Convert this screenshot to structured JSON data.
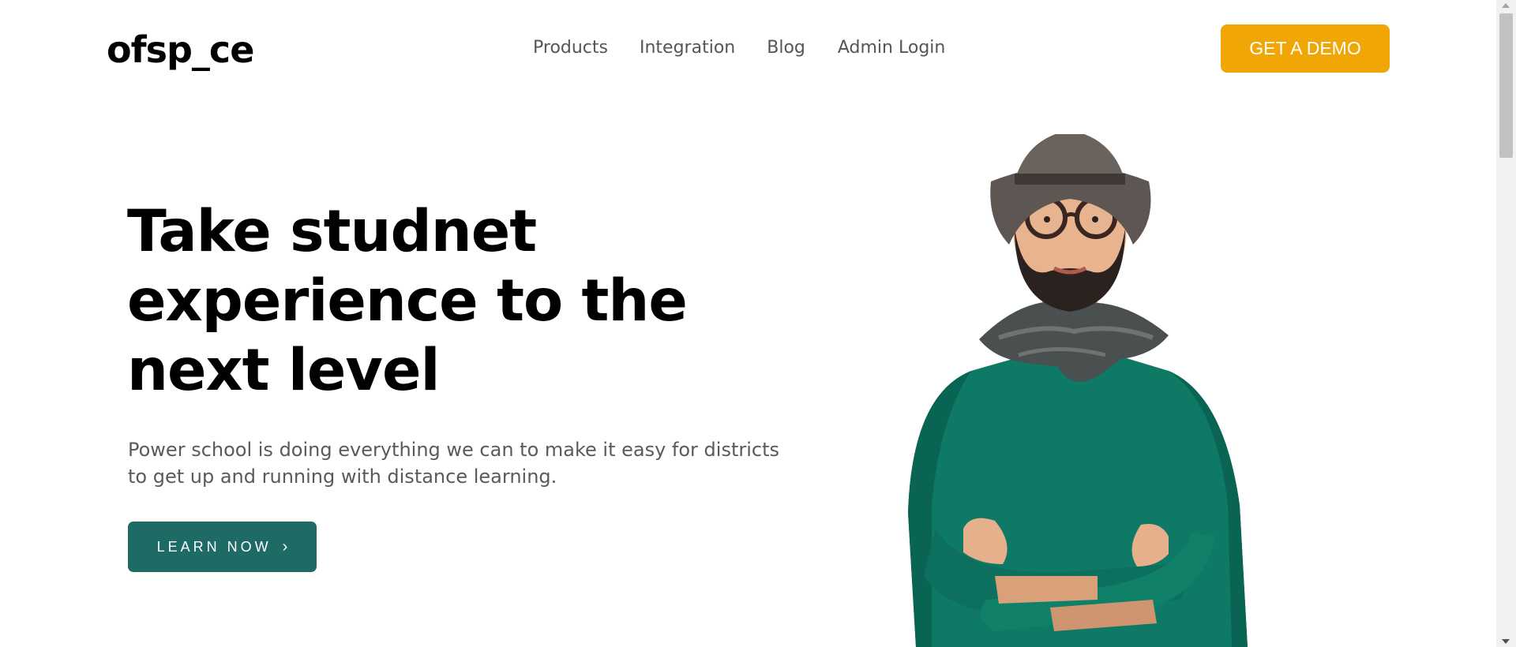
{
  "header": {
    "logo": "ofsp_ce",
    "nav": [
      "Products",
      "Integration",
      "Blog",
      "Admin Login"
    ],
    "cta": "GET A DEMO"
  },
  "hero": {
    "title": "Take studnet experience to the next level",
    "description": "Power school is doing everything we can to make it easy for districts to get up and running with distance learning.",
    "button": "LEARN NOW",
    "button_icon": "chevron-right-icon"
  },
  "colors": {
    "demo_button": "#f0a705",
    "learn_button": "#1e6b66",
    "sweater": "#0e7a66"
  }
}
